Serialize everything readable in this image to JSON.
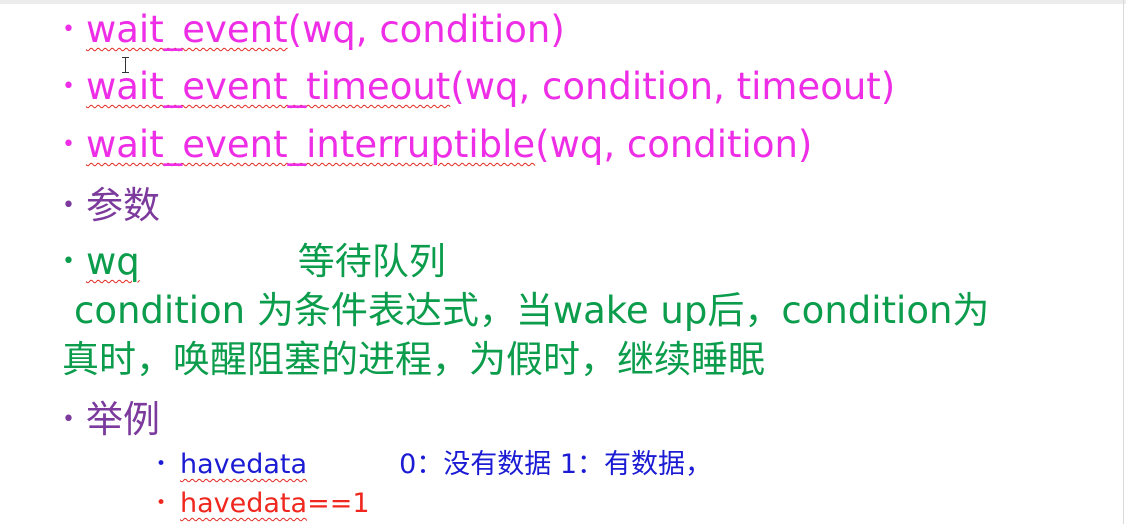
{
  "slide": {
    "line1": {
      "code": "wait_event",
      "args": "(wq, condition)"
    },
    "line2": {
      "code": "wait_event_timeout",
      "args": "(wq, condition, timeout)"
    },
    "line3": {
      "code": "wait_event_interruptible",
      "args": "(wq, condition)"
    },
    "params_heading": "参数",
    "wq_term": "wq",
    "wq_desc": "等待队列",
    "condition_line1": "condition  为条件表达式，当wake up后，condition为",
    "condition_line2": "真时，唤醒阻塞的进程，为假时，继续睡眠",
    "example_heading": "举例",
    "sub1": {
      "term": "havedata",
      "desc": "0：没有数据 1：有数据，"
    },
    "sub2": {
      "term": "havedata",
      "rest": "==1"
    }
  },
  "colors": {
    "function": "#ee2ee6",
    "heading": "#7b3a9c",
    "param": "#0b9c4c",
    "sub1": "#1b1bd4",
    "sub2": "#f0271e",
    "spellcheck": "#e2281f"
  },
  "icons": {
    "cursor": "text-cursor-icon",
    "bullet": "bullet-dot-icon"
  }
}
